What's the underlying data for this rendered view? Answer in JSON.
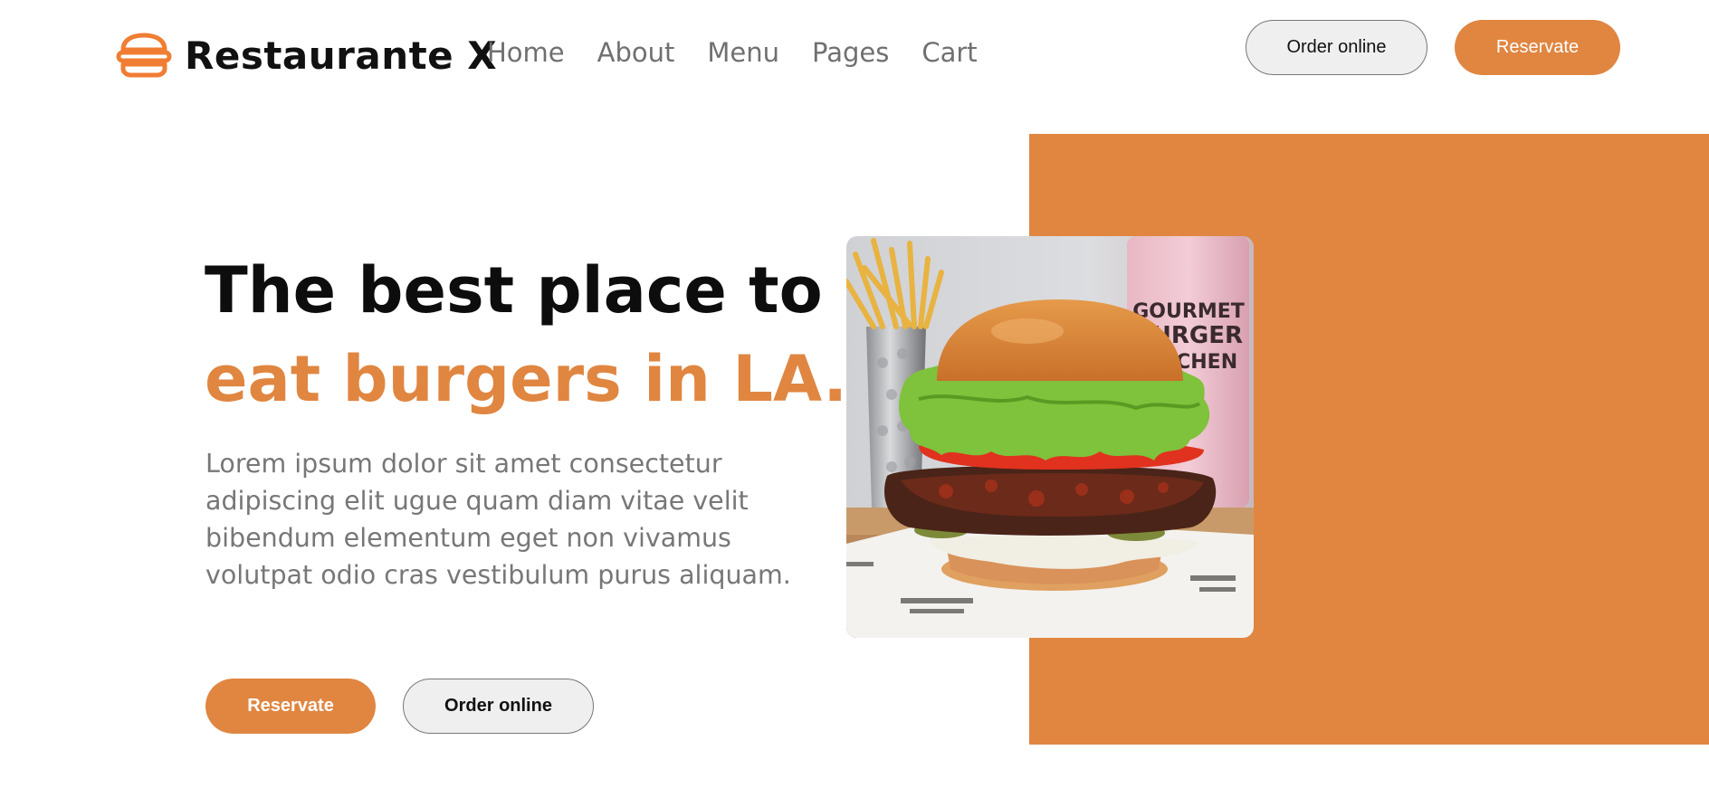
{
  "header": {
    "logo_text": "Restaurante X",
    "logo_icon": "burger-icon",
    "nav": [
      {
        "label": "Home"
      },
      {
        "label": "About"
      },
      {
        "label": "Menu"
      },
      {
        "label": "Pages"
      },
      {
        "label": "Cart"
      }
    ],
    "order_label": "Order online",
    "reserve_label": "Reservate"
  },
  "hero": {
    "title_line1": "The best place to",
    "title_line2": "eat burgers in LA.",
    "description_lines": [
      "Lorem ipsum dolor sit amet consectetur",
      "adipiscing elit ugue quam diam vitae velit",
      "bibendum elementum eget non vivamus",
      "volutpat odio cras vestibulum purus aliquam."
    ],
    "reserve_label": "Reservate",
    "order_label": "Order online",
    "photo_cup_text": [
      "GOURMET",
      "BURGER",
      "KITCHEN"
    ]
  },
  "colors": {
    "accent": "#e08641",
    "text_dark": "#0d0d0d",
    "text_muted": "#777777",
    "button_outline_bg": "#efefef"
  }
}
